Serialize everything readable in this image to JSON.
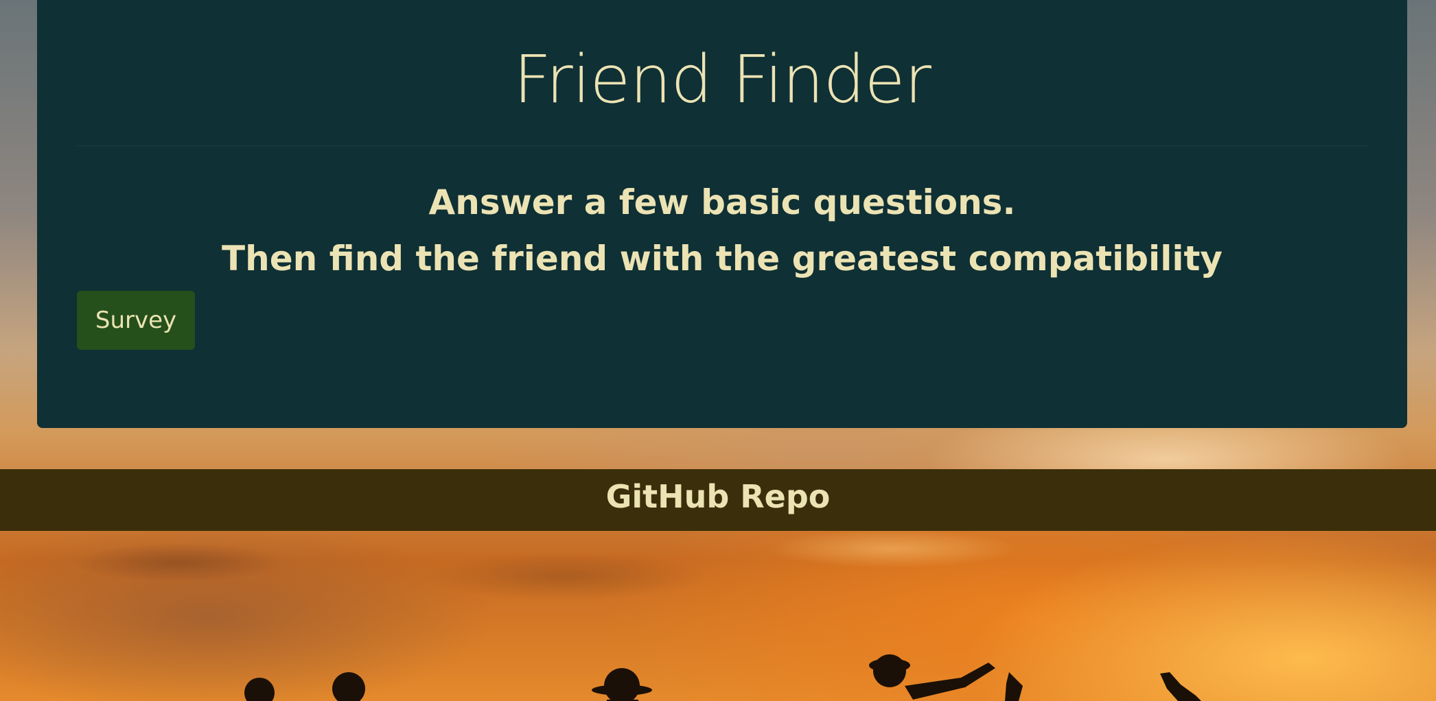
{
  "jumbotron": {
    "title": "Friend Finder",
    "lead_lines": [
      "Answer a few basic questions.",
      "Then find the friend with the greatest compatibility"
    ],
    "survey_button": "Survey"
  },
  "footer": {
    "link_label": "GitHub Repo"
  },
  "colors": {
    "jumbotron_bg": "#0f3034",
    "text": "#ece3b4",
    "button_bg": "#25501b",
    "footer_bg": "#3a2f0a"
  }
}
